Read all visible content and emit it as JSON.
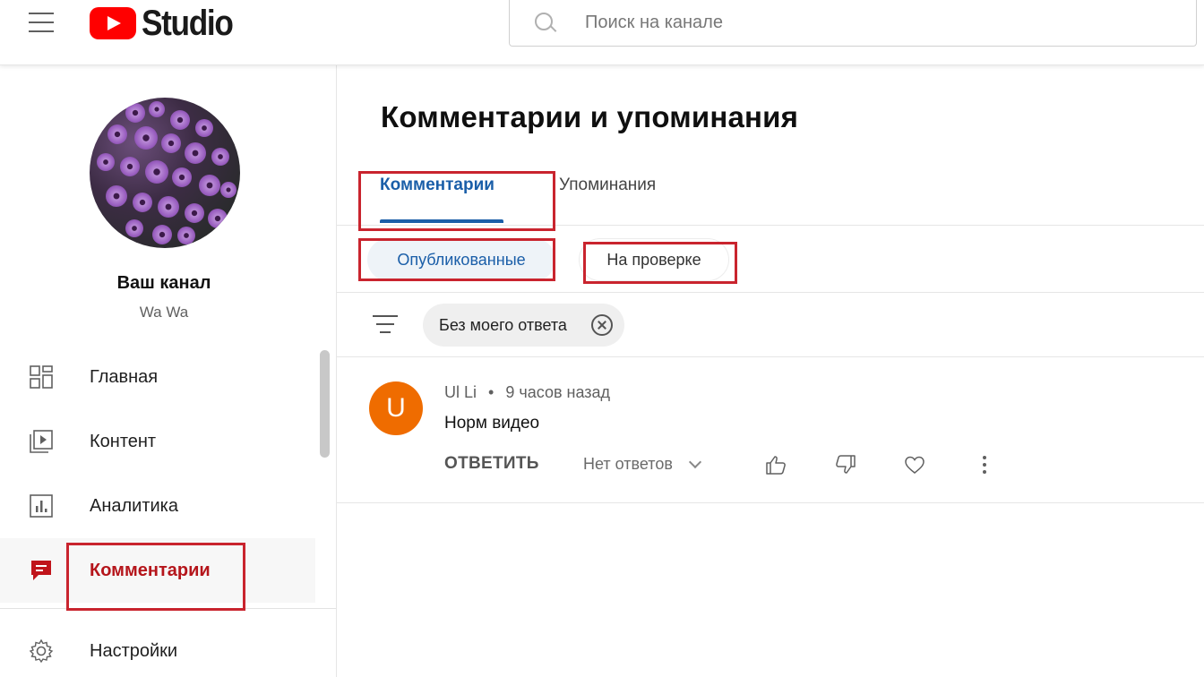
{
  "header": {
    "logo_text": "Studio",
    "search_placeholder": "Поиск на канале"
  },
  "sidebar": {
    "channel_title": "Ваш канал",
    "channel_name": "Wa Wa",
    "items": [
      {
        "label": "Главная",
        "icon": "dashboard-icon"
      },
      {
        "label": "Контент",
        "icon": "video-content-icon"
      },
      {
        "label": "Аналитика",
        "icon": "analytics-icon"
      },
      {
        "label": "Комментарии",
        "icon": "comments-icon",
        "active": true
      },
      {
        "label": "Настройки",
        "icon": "gear-icon"
      }
    ]
  },
  "main": {
    "title": "Комментарии и упоминания",
    "tabs": [
      {
        "label": "Комментарии",
        "active": true
      },
      {
        "label": "Упоминания",
        "active": false
      }
    ],
    "subtabs": [
      {
        "label": "Опубликованные",
        "active": true
      },
      {
        "label": "На проверке",
        "active": false
      }
    ],
    "filter_chip": "Без моего ответа",
    "comment": {
      "avatar_letter": "U",
      "author": "Ul Li",
      "separator": "•",
      "time": "9 часов назад",
      "text": "Норм видео",
      "reply_label": "ОТВЕТИТЬ",
      "replies_label": "Нет ответов"
    }
  },
  "colors": {
    "accent_blue": "#1a5ea8",
    "active_red": "#b5151b",
    "highlight_red": "#c9242e",
    "avatar_orange": "#ef6c00",
    "youtube_red": "#ff0000"
  }
}
